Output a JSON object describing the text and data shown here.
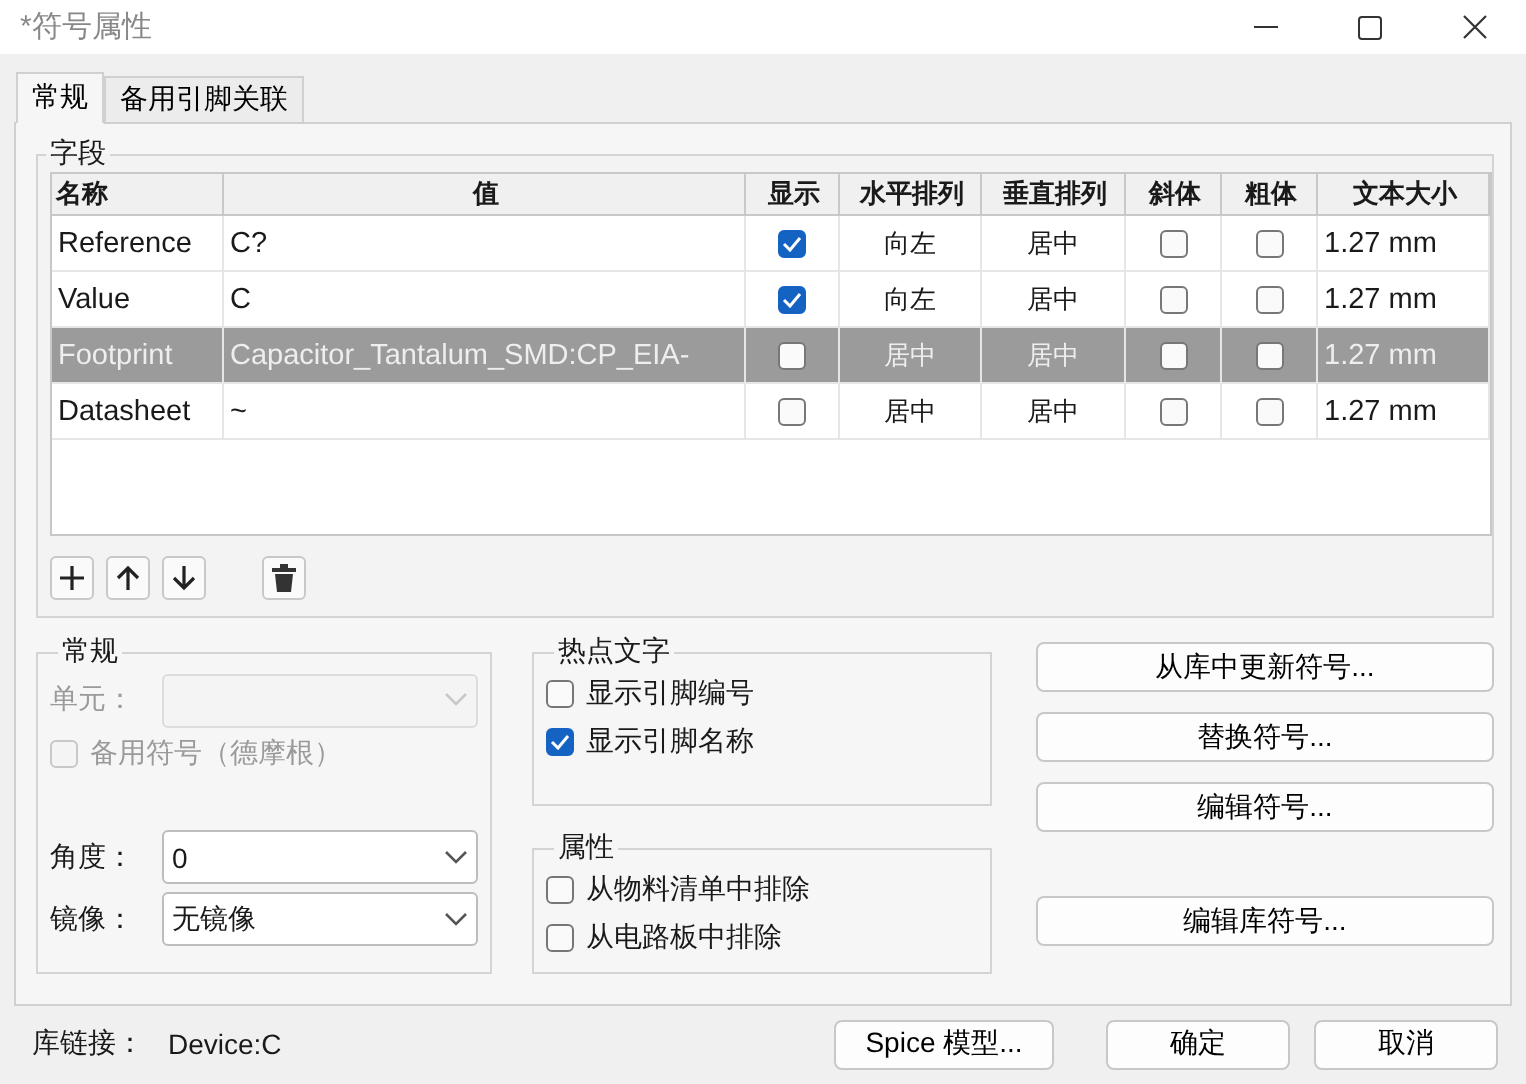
{
  "window": {
    "title": "*符号属性"
  },
  "tabs": [
    {
      "label": "常规",
      "selected": true
    },
    {
      "label": "备用引脚关联",
      "selected": false
    }
  ],
  "fields": {
    "legend": "字段",
    "columns": [
      "名称",
      "值",
      "显示",
      "水平排列",
      "垂直排列",
      "斜体",
      "粗体",
      "文本大小"
    ],
    "rows": [
      {
        "name": "Reference",
        "value": "C?",
        "show": true,
        "h_align": "向左",
        "v_align": "居中",
        "italic": false,
        "bold": false,
        "size": "1.27 mm",
        "selected": false
      },
      {
        "name": "Value",
        "value": "C",
        "show": true,
        "h_align": "向左",
        "v_align": "居中",
        "italic": false,
        "bold": false,
        "size": "1.27 mm",
        "selected": false
      },
      {
        "name": "Footprint",
        "value": "Capacitor_Tantalum_SMD:CP_EIA-",
        "show": false,
        "h_align": "居中",
        "v_align": "居中",
        "italic": false,
        "bold": false,
        "size": "1.27 mm",
        "selected": true
      },
      {
        "name": "Datasheet",
        "value": "~",
        "show": false,
        "h_align": "居中",
        "v_align": "居中",
        "italic": false,
        "bold": false,
        "size": "1.27 mm",
        "selected": false
      }
    ]
  },
  "general": {
    "legend": "常规",
    "unit": {
      "label": "单元：",
      "disabled": true
    },
    "alternate": {
      "label": "备用符号（德摩根）",
      "checked": false,
      "disabled": true
    },
    "angle": {
      "label": "角度：",
      "value": "0"
    },
    "mirror": {
      "label": "镜像：",
      "value": "无镜像"
    }
  },
  "hotspot_text": {
    "legend": "热点文字",
    "options": [
      {
        "label": "显示引脚编号",
        "checked": false
      },
      {
        "label": "显示引脚名称",
        "checked": true
      }
    ]
  },
  "attributes": {
    "legend": "属性",
    "options": [
      {
        "label": "从物料清单中排除",
        "checked": false
      },
      {
        "label": "从电路板中排除",
        "checked": false
      }
    ]
  },
  "actions": [
    "从库中更新符号...",
    "替换符号...",
    "编辑符号...",
    "编辑库符号..."
  ],
  "footer": {
    "library_link_label": "库链接：",
    "library_link": "Device:C",
    "buttons": [
      "Spice 模型...",
      "确定",
      "取消"
    ]
  }
}
